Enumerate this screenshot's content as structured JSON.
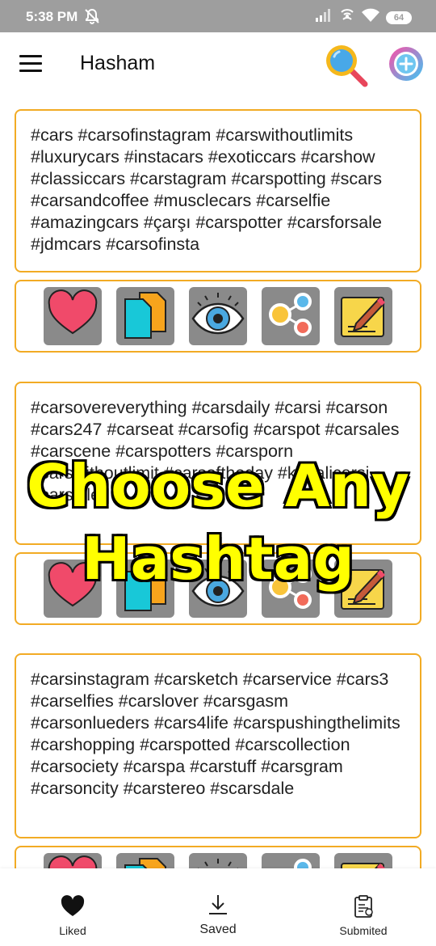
{
  "status_bar": {
    "time": "5:38 PM",
    "battery": "64"
  },
  "app_bar": {
    "title": "Hasham",
    "icons": [
      "menu-icon",
      "search-icon",
      "add-icon"
    ]
  },
  "hashtag_sets": [
    {
      "text": "#cars #carsofinstagram #carswithoutlimits #luxurycars #instacars #exoticcars #carshow #classiccars #carstagram #carspotting #scars #carsandcoffee #musclecars #carselfie #amazingcars #çarşı #carspotter #carsforsale #jdmcars #carsofinsta"
    },
    {
      "text": "#carsovereverything #carsdaily #carsi #carson #cars247 #carseat #carsofig #carspot #carsales #carscene #carspotters #carsporn #carswithoutlimit #carsoftheday #kapalicarsi #carstyle"
    },
    {
      "text": "#carsinstagram #carsketch #carservice #cars3 #carselfies #carslover #carsgasm #carsonlueders #cars4life #carspushingthelimits #carshopping #carspotted #carscollection #carsociety #carspa #carstuff #carsgram #carsoncity #carstereo #scarsdale"
    }
  ],
  "card_actions": [
    "heart-icon",
    "copy-icon",
    "eye-icon",
    "share-icon",
    "edit-icon"
  ],
  "overlay": {
    "line1": "Choose Any",
    "line2": "Hashtag"
  },
  "bottom_nav": [
    {
      "label": "Liked",
      "icon": "heart-icon"
    },
    {
      "label": "Saved",
      "icon": "download-icon"
    },
    {
      "label": "Submited",
      "icon": "clipboard-icon"
    }
  ],
  "colors": {
    "card_border": "#f2ab24",
    "status_bar": "#9e9e9e",
    "overlay_text": "#ffff00"
  }
}
